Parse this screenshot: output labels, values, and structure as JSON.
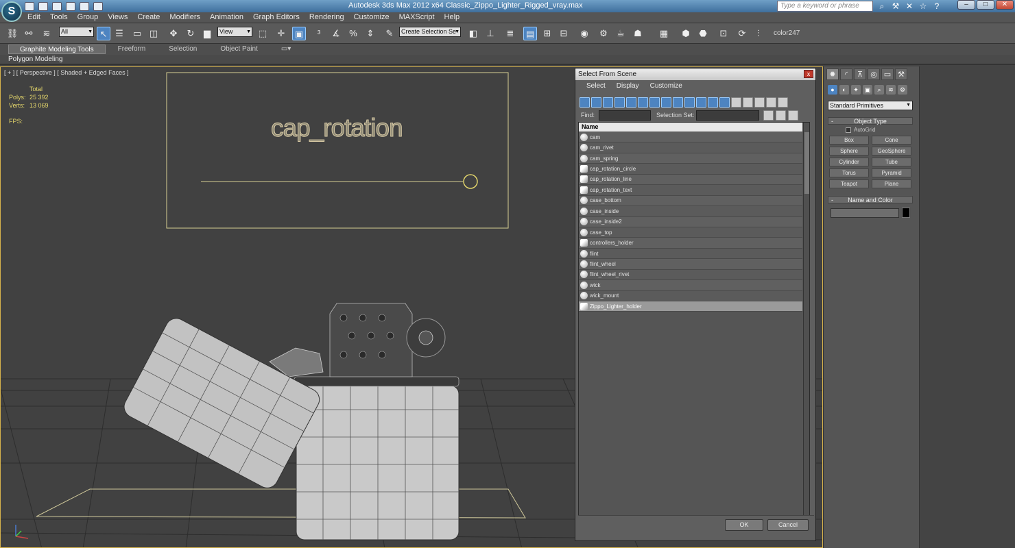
{
  "app": {
    "logo_glyph": "S",
    "title": "Autodesk 3ds Max  2012 x64      Classic_Zippo_Lighter_Rigged_vray.max",
    "help_search_placeholder": "Type a keyword or phrase"
  },
  "menu": [
    "Edit",
    "Tools",
    "Group",
    "Views",
    "Create",
    "Modifiers",
    "Animation",
    "Graph Editors",
    "Rendering",
    "Customize",
    "MAXScript",
    "Help"
  ],
  "toolbar": {
    "selection_filter": "All",
    "reference_coord": "View",
    "named_selection": "Create Selection Se",
    "color_label": "color247"
  },
  "ribbon": {
    "tabs": [
      "Graphite Modeling Tools",
      "Freeform",
      "Selection",
      "Object Paint"
    ],
    "active_tab": "Graphite Modeling Tools",
    "sub_label": "Polygon Modeling"
  },
  "viewport": {
    "label": "[ + ] [ Perspective ] [ Shaded + Edged Faces ]",
    "stats_header": "Total",
    "polys_label": "Polys:",
    "polys_value": "25 392",
    "verts_label": "Verts:",
    "verts_value": "13 069",
    "fps_label": "FPS:",
    "control_text": "cap_rotation"
  },
  "dialog": {
    "title": "Select From Scene",
    "close_glyph": "x",
    "menus": [
      "Select",
      "Display",
      "Customize"
    ],
    "find_label": "Find:",
    "selection_set_label": "Selection Set:",
    "column_header": "Name",
    "objects": [
      {
        "name": "cam",
        "kind": "mesh"
      },
      {
        "name": "cam_rivet",
        "kind": "mesh"
      },
      {
        "name": "cam_spring",
        "kind": "mesh"
      },
      {
        "name": "cap_rotation_circle",
        "kind": "shape"
      },
      {
        "name": "cap_rotation_line",
        "kind": "shape"
      },
      {
        "name": "cap_rotation_text",
        "kind": "shape"
      },
      {
        "name": "case_bottom",
        "kind": "mesh"
      },
      {
        "name": "case_inside",
        "kind": "mesh"
      },
      {
        "name": "case_inside2",
        "kind": "mesh"
      },
      {
        "name": "case_top",
        "kind": "mesh"
      },
      {
        "name": "controllers_holder",
        "kind": "shape"
      },
      {
        "name": "flint",
        "kind": "mesh"
      },
      {
        "name": "flint_wheel",
        "kind": "mesh"
      },
      {
        "name": "flint_wheel_rivet",
        "kind": "mesh"
      },
      {
        "name": "wick",
        "kind": "mesh"
      },
      {
        "name": "wick_mount",
        "kind": "mesh"
      },
      {
        "name": "Zippo_Lighter_holder",
        "kind": "shape"
      }
    ],
    "selected_object": "Zippo_Lighter_holder",
    "ok_label": "OK",
    "cancel_label": "Cancel"
  },
  "command_panel": {
    "category": "Standard Primitives",
    "object_type_header": "Object Type",
    "autogrid_label": "AutoGrid",
    "primitives": [
      "Box",
      "Cone",
      "Sphere",
      "GeoSphere",
      "Cylinder",
      "Tube",
      "Torus",
      "Pyramid",
      "Teapot",
      "Plane"
    ],
    "name_color_header": "Name and Color"
  },
  "colors": {
    "accent_blue": "#4d84c1",
    "viewport_border": "#d7b34c",
    "stats_text": "#e6d86b"
  }
}
